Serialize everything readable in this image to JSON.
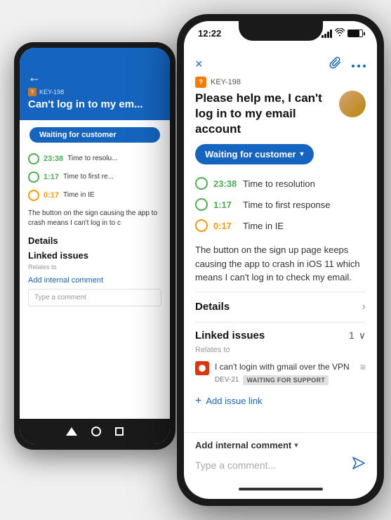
{
  "scene": {
    "background": "#f0f0f0"
  },
  "back_phone": {
    "time": "",
    "key_label": "KEY-198",
    "title": "Can't log in to my em...",
    "status_button": "Waiting for customer",
    "metrics": [
      {
        "value": "23:38",
        "label": "Time to resolu...",
        "color": "green"
      },
      {
        "value": "1:17",
        "label": "Time to first re...",
        "color": "green"
      },
      {
        "value": "0:17",
        "label": "Time in IE",
        "color": "orange"
      }
    ],
    "description": "The button on the sign causing the app to crash means I can't log in to c",
    "details_label": "Details",
    "linked_label": "Linked issues",
    "relates_to": "Relates to",
    "add_comment": "Add internal comment",
    "comment_placeholder": "Type a comment"
  },
  "front_phone": {
    "status_bar": {
      "time": "12:22",
      "signal": "●●●●",
      "wifi": "wifi",
      "battery": "battery"
    },
    "header": {
      "close_label": "×",
      "paperclip_label": "📎",
      "dots_label": "..."
    },
    "issue": {
      "key": "KEY-198",
      "title": "Please help me, I can't log in to my email account",
      "status": "Waiting for customer"
    },
    "metrics": [
      {
        "value": "23:38",
        "label": "Time to resolution",
        "color": "green"
      },
      {
        "value": "1:17",
        "label": "Time to first response",
        "color": "green"
      },
      {
        "value": "0:17",
        "label": "Time in IE",
        "color": "orange"
      }
    ],
    "description": "The button on the sign up page keeps causing the app to crash in iOS 11 which means I can't log in to check my email.",
    "details_label": "Details",
    "linked_issues_label": "Linked issues",
    "linked_count": "1",
    "relates_to": "Relates to",
    "linked_issue": {
      "text": "I can't login with gmail over the VPN",
      "dev_key": "DEV-21",
      "badge": "WAITING FOR SUPPORT"
    },
    "add_issue_link": "Add issue link",
    "bottom": {
      "add_comment": "Add internal comment",
      "comment_placeholder": "Type a comment..."
    }
  }
}
